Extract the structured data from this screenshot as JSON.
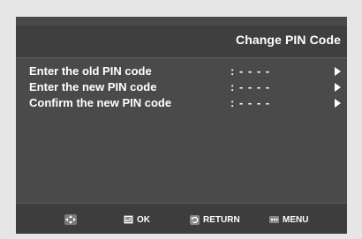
{
  "header": {
    "title": "Change PIN Code"
  },
  "menu": {
    "items": [
      {
        "label": "Enter the old PIN code",
        "value": ": - - - -",
        "arrow_icon": "right-triangle-icon"
      },
      {
        "label": "Enter the new PIN code",
        "value": ": - - - -",
        "arrow_icon": "right-triangle-icon"
      },
      {
        "label": "Confirm the new PIN code",
        "value": ": - - - -",
        "arrow_icon": "right-triangle-icon"
      }
    ]
  },
  "footer": {
    "navigate_icon": "directional-pad-icon",
    "ok_icon": "enter-key-icon",
    "ok_label": "OK",
    "return_icon": "return-arrow-icon",
    "return_label": "RETURN",
    "menu_icon": "menu-button-icon",
    "menu_label": "MENU"
  },
  "colors": {
    "page_background": "#e6e6e6",
    "panel_background": "#4a4a4a",
    "header_background": "#3f3f3f",
    "footer_background": "#3d3d3d",
    "text": "#ffffff",
    "icon_gray": "#8a8a8a"
  }
}
